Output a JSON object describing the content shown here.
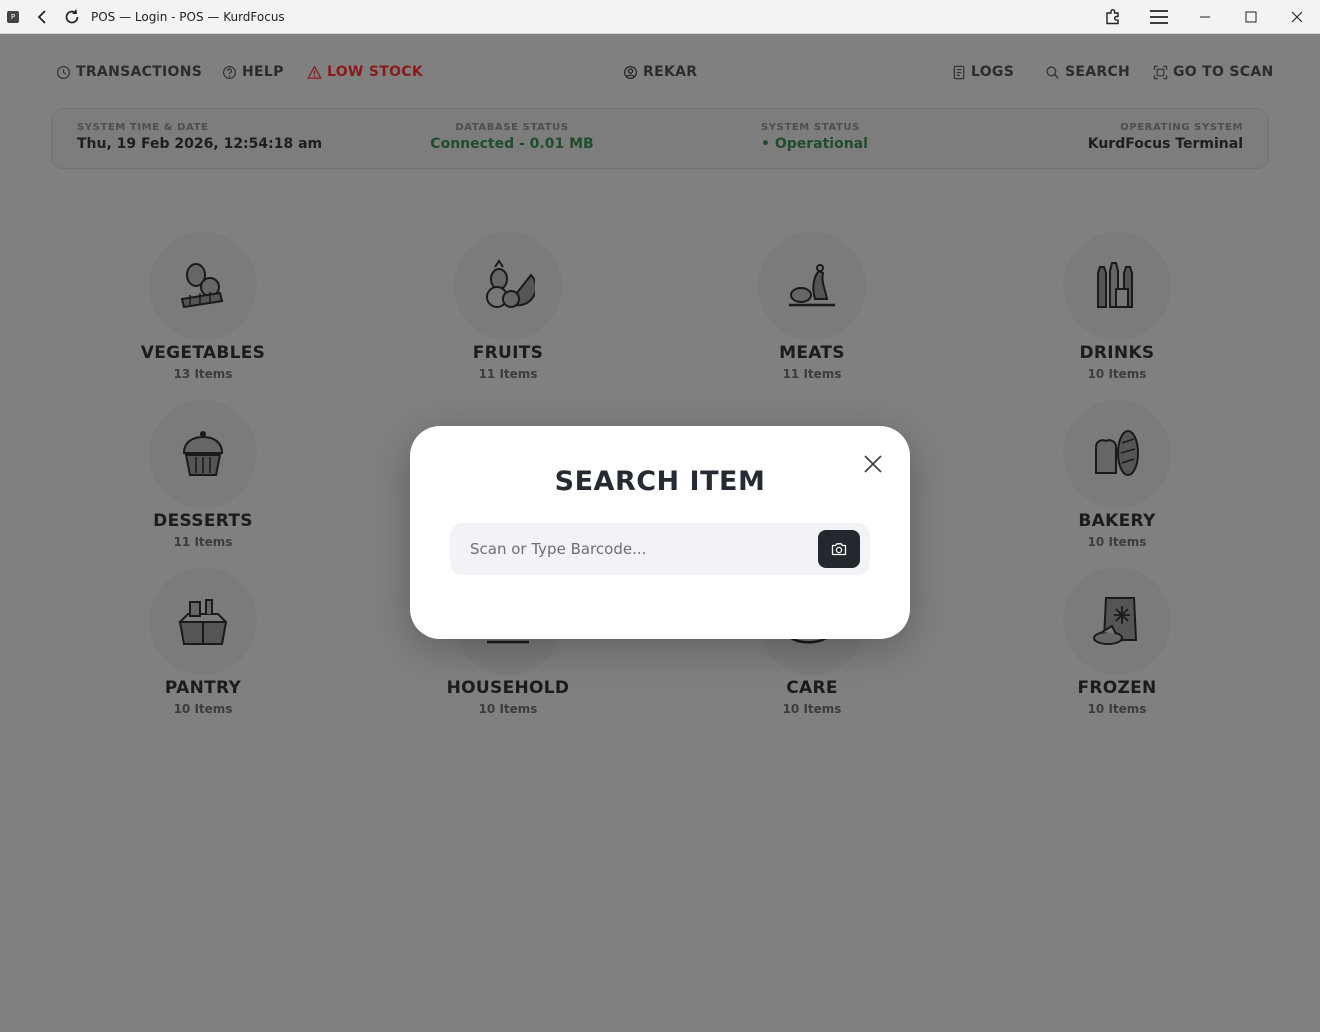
{
  "window": {
    "title": "POS — Login - POS — KurdFocus",
    "app_icon": "P"
  },
  "nav": {
    "transactions": "TRANSACTIONS",
    "help": "HELP",
    "low_stock": "LOW STOCK",
    "user": "REKAR",
    "logs": "LOGS",
    "search": "SEARCH",
    "go_to_scan": "GO TO SCAN"
  },
  "status": {
    "time_label": "SYSTEM TIME & DATE",
    "time_value": "Thu, 19 Feb 2026, 12:54:18 am",
    "db_label": "DATABASE STATUS",
    "db_value": "Connected - 0.01 MB",
    "sys_label": "SYSTEM STATUS",
    "sys_value": "• Operational",
    "os_label": "OPERATING SYSTEM",
    "os_value": "KurdFocus Terminal"
  },
  "categories": [
    {
      "name": "VEGETABLES",
      "count": "13 Items",
      "icon": "vegetables-icon"
    },
    {
      "name": "FRUITS",
      "count": "11 Items",
      "icon": "fruits-icon"
    },
    {
      "name": "MEATS",
      "count": "11 Items",
      "icon": "meats-icon"
    },
    {
      "name": "DRINKS",
      "count": "10 Items",
      "icon": "drinks-icon"
    },
    {
      "name": "DESSERTS",
      "count": "11 Items",
      "icon": "desserts-icon"
    },
    {
      "name": "BAKERY",
      "count": "10 Items",
      "icon": "bakery-icon"
    },
    {
      "name": "PANTRY",
      "count": "10 Items",
      "icon": "pantry-icon"
    },
    {
      "name": "HOUSEHOLD",
      "count": "10 Items",
      "icon": "household-icon"
    },
    {
      "name": "CARE",
      "count": "10 Items",
      "icon": "care-icon"
    },
    {
      "name": "FROZEN",
      "count": "10 Items",
      "icon": "frozen-icon"
    }
  ],
  "modal": {
    "title": "SEARCH ITEM",
    "placeholder": "Scan or Type Barcode..."
  }
}
